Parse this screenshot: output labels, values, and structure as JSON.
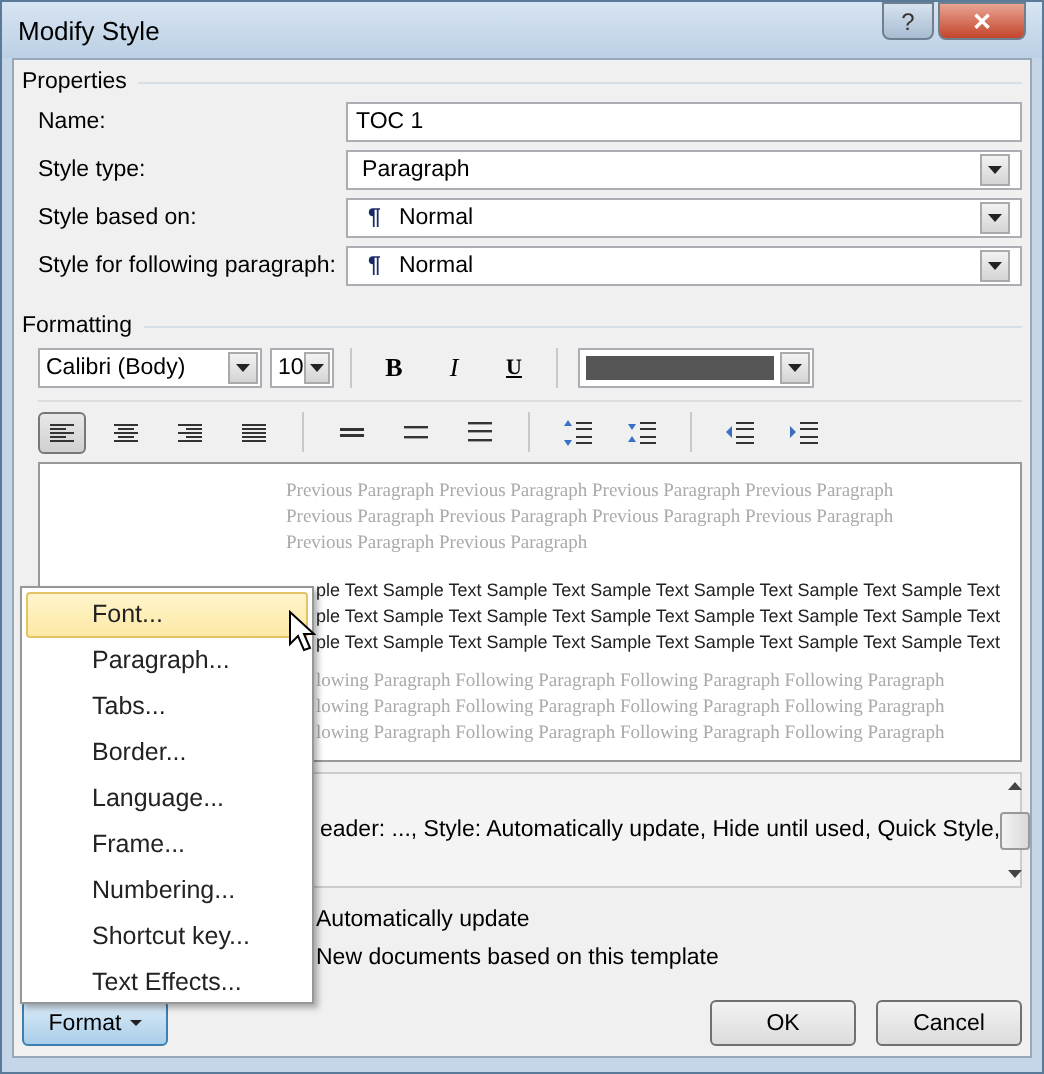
{
  "window": {
    "title": "Modify Style",
    "help_button": "?",
    "close_button": "✕"
  },
  "properties": {
    "label": "Properties",
    "fields": [
      {
        "label": "Name:",
        "kind": "text",
        "value": "TOC 1"
      },
      {
        "label": "Style type:",
        "kind": "combo",
        "value": "Paragraph"
      },
      {
        "label": "Style based on:",
        "kind": "combo",
        "value": "Normal",
        "pilcrow": "¶"
      },
      {
        "label": "Style for following paragraph:",
        "kind": "combo",
        "value": "Normal",
        "pilcrow": "¶"
      }
    ]
  },
  "formatting": {
    "label": "Formatting",
    "font": "Calibri (Body)",
    "size": "10",
    "bold": "B",
    "italic": "I",
    "underline": "U",
    "alignments": [
      {
        "kind": "left",
        "selected": true
      },
      {
        "kind": "center",
        "selected": false
      },
      {
        "kind": "right",
        "selected": false
      },
      {
        "kind": "justify",
        "selected": false
      }
    ],
    "preview": {
      "previous": [
        "Previous Paragraph Previous Paragraph Previous Paragraph Previous Paragraph",
        "Previous Paragraph Previous Paragraph Previous Paragraph Previous Paragraph",
        "Previous Paragraph Previous Paragraph"
      ],
      "sample": [
        "ple Text Sample Text Sample Text Sample Text Sample Text Sample Text Sample Text",
        "ple Text Sample Text Sample Text Sample Text Sample Text Sample Text Sample Text",
        "ple Text Sample Text Sample Text Sample Text Sample Text Sample Text Sample Text"
      ],
      "following": [
        "lowing Paragraph Following Paragraph Following Paragraph Following Paragraph",
        "lowing Paragraph Following Paragraph Following Paragraph Following Paragraph",
        "lowing Paragraph Following Paragraph Following Paragraph Following Paragraph"
      ]
    },
    "description": "eader: ..., Style: Automatically update, Hide until used, Quick Style,"
  },
  "options": [
    "Automatically update",
    "New documents based on this template"
  ],
  "format_menu": [
    {
      "label": "Font...",
      "selected": true
    },
    {
      "label": "Paragraph...",
      "selected": false
    },
    {
      "label": "Tabs...",
      "selected": false
    },
    {
      "label": "Border...",
      "selected": false
    },
    {
      "label": "Language...",
      "selected": false
    },
    {
      "label": "Frame...",
      "selected": false
    },
    {
      "label": "Numbering...",
      "selected": false
    },
    {
      "label": "Shortcut key...",
      "selected": false
    },
    {
      "label": "Text Effects...",
      "selected": false
    }
  ],
  "buttons": {
    "format": "Format",
    "ok": "OK",
    "cancel": "Cancel"
  }
}
